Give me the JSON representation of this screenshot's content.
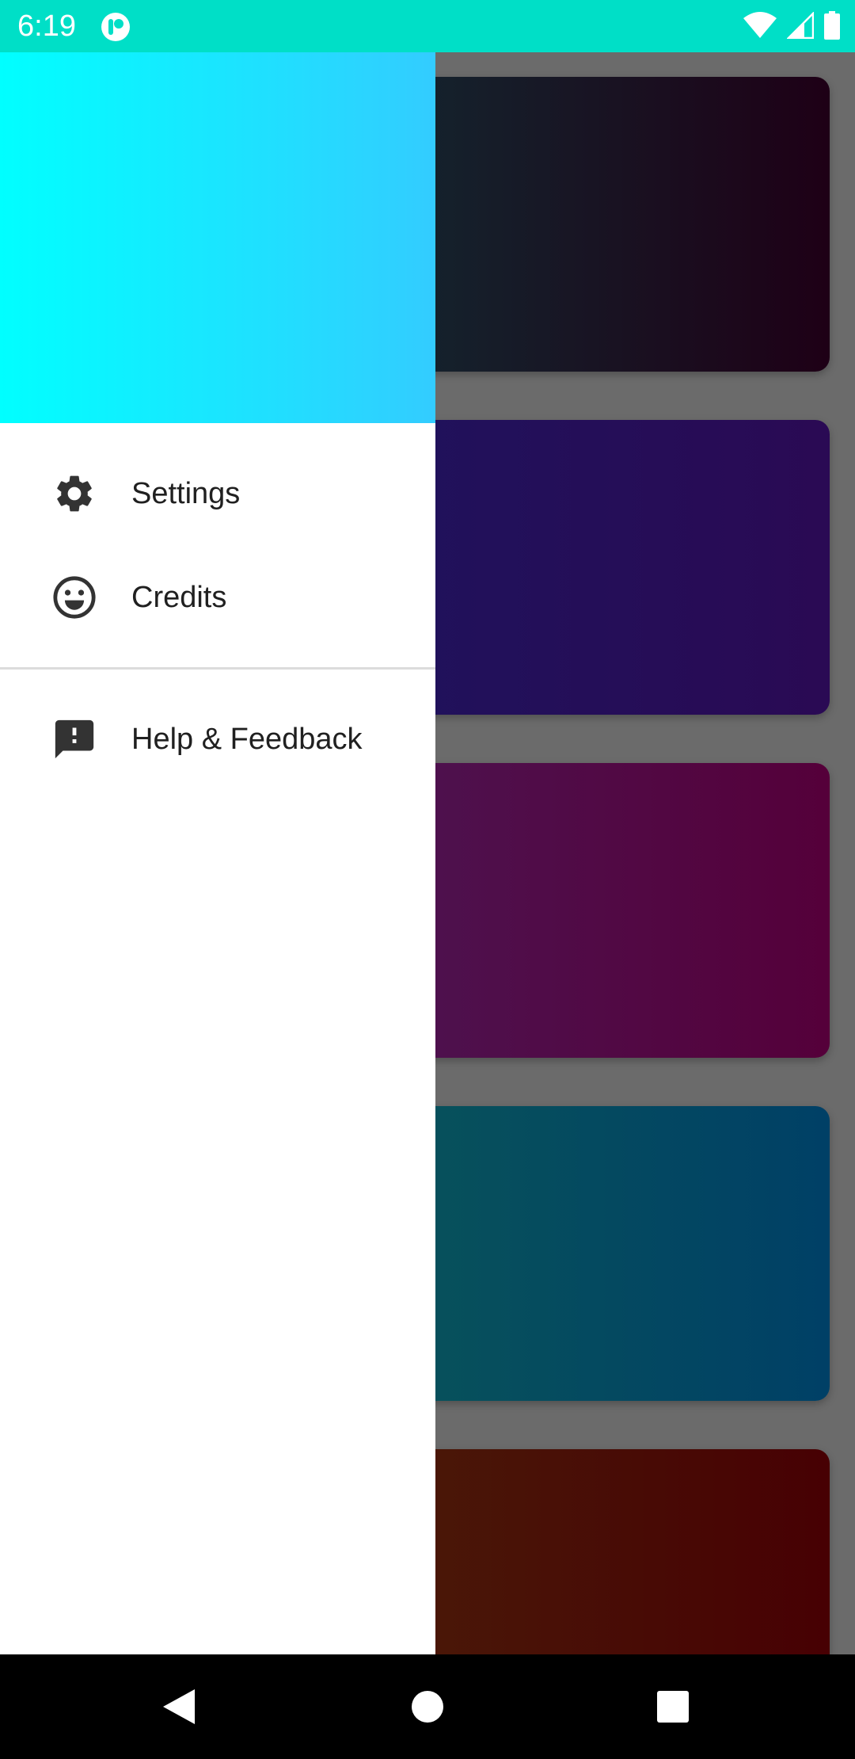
{
  "status_bar": {
    "time": "6:19",
    "background": "#00dfc7",
    "icons": [
      "app-notification-icon",
      "wifi-icon",
      "cell-signal-icon",
      "battery-icon"
    ]
  },
  "drawer": {
    "header_gradient": [
      "#00ffff",
      "#33ccff"
    ],
    "items": [
      {
        "label": "Settings",
        "icon": "gear-icon"
      },
      {
        "label": "Credits",
        "icon": "smiley-face-icon"
      }
    ],
    "secondary_items": [
      {
        "label": "Help & Feedback",
        "icon": "feedback-icon"
      }
    ]
  },
  "background_cards": [
    {
      "gradient": [
        "#13262f",
        "#1e0016"
      ]
    },
    {
      "gradient": [
        "#1f125c",
        "#2a0a54"
      ]
    },
    {
      "gradient": [
        "#4d1350",
        "#55003a"
      ]
    },
    {
      "gradient": [
        "#08535a",
        "#004066"
      ]
    },
    {
      "gradient": [
        "#4a1a08",
        "#470003"
      ]
    }
  ],
  "nav_bar": {
    "buttons": [
      "back-icon",
      "home-icon",
      "recents-icon"
    ]
  }
}
